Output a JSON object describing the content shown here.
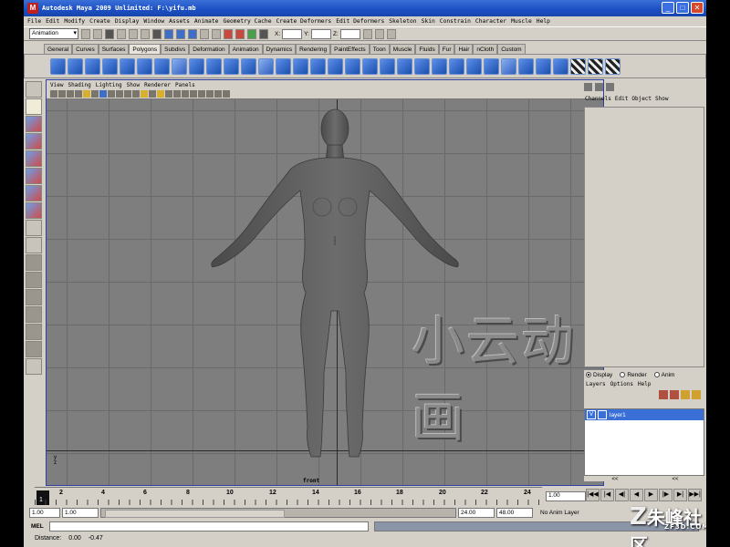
{
  "window": {
    "title": "Autodesk Maya 2009 Unlimited: F:\\yifu.mb",
    "min_label": "_",
    "max_label": "□",
    "close_label": "✕"
  },
  "menubar": [
    "File",
    "Edit",
    "Modify",
    "Create",
    "Display",
    "Window",
    "Assets",
    "Animate",
    "Geometry Cache",
    "Create Deformers",
    "Edit Deformers",
    "Skeleton",
    "Skin",
    "Constrain",
    "Character",
    "Muscle",
    "Help"
  ],
  "status_line": {
    "mode": "Animation",
    "x_label": "X:",
    "y_label": "Y:",
    "z_label": "Z:"
  },
  "shelf_tabs": [
    "General",
    "Curves",
    "Surfaces",
    "Polygons",
    "Subdivs",
    "Deformation",
    "Animation",
    "Dynamics",
    "Rendering",
    "PaintEffects",
    "Toon",
    "Muscle",
    "Fluids",
    "Fur",
    "Hair",
    "nCloth",
    "Custom"
  ],
  "shelf_active": "Polygons",
  "viewport": {
    "menu": [
      "View",
      "Shading",
      "Lighting",
      "Show",
      "Renderer",
      "Panels"
    ],
    "camera_label": "front",
    "watermark": "小云动画",
    "gnomon_y": "y",
    "gnomon_z": "z"
  },
  "channel_box": {
    "menu": [
      "Channels",
      "Edit",
      "Object",
      "Show"
    ]
  },
  "layer_editor": {
    "modes": [
      "Display",
      "Render",
      "Anim"
    ],
    "selected_mode": "Display",
    "menu": [
      "Layers",
      "Options",
      "Help"
    ],
    "layers": [
      {
        "visible": "V",
        "name": "layer1"
      }
    ],
    "nav_left": "<<",
    "nav_right": "<<"
  },
  "timeline": {
    "current_frame": "1",
    "ticks": [
      "2",
      "4",
      "6",
      "8",
      "10",
      "12",
      "14",
      "16",
      "18",
      "20",
      "22",
      "24"
    ],
    "frame_field": "1.00"
  },
  "playback_buttons": [
    "|◀◀",
    "|◀",
    "◀|",
    "◀",
    "▶",
    "|▶",
    "▶|",
    "▶▶|"
  ],
  "range": {
    "start": "1.00",
    "playback_start": "1.00",
    "playback_end": "24.00",
    "end": "48.00",
    "anim_layer": "No Anim Layer"
  },
  "command_line": {
    "label": "MEL"
  },
  "help_line": {
    "distance_label": "Distance:",
    "value1": "0.00",
    "value2": "-0.47"
  },
  "logo": {
    "text": "朱峰社区",
    "sub": "ZF3D.COM"
  },
  "colors": {
    "title_bar": "#1b4fc2",
    "viewport_bg": "#7e7e7e",
    "layer_selected": "#3a6fd8"
  }
}
